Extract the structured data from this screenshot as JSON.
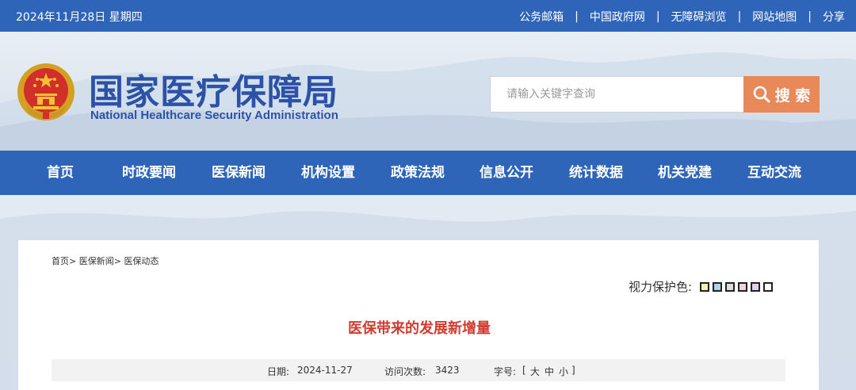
{
  "topbar": {
    "date": "2024年11月28日 星期四",
    "links": [
      "公务邮箱",
      "中国政府网",
      "无障碍浏览",
      "网站地图",
      "分享"
    ],
    "separator": "|"
  },
  "header": {
    "title": "国家医疗保障局",
    "subtitle": "National Healthcare Security Administration",
    "emblem_icon": "national-emblem-icon"
  },
  "search": {
    "placeholder": "请输入关键字查询",
    "button_label": "搜 索",
    "button_color": "#e8895a"
  },
  "nav": {
    "items": [
      "首页",
      "时政要闻",
      "医保新闻",
      "机构设置",
      "政策法规",
      "信息公开",
      "统计数据",
      "机关党建",
      "互动交流"
    ],
    "bg_color": "#2f65b9"
  },
  "breadcrumb": {
    "items": [
      "首页",
      "医保新闻",
      "医保动态"
    ],
    "separator": ">"
  },
  "vision": {
    "label": "视力保护色:",
    "swatches": [
      "#f7f3a8",
      "#a9d4ec",
      "#dcdcdc",
      "#f3d3d8",
      "#dccff0",
      "#ffffff"
    ]
  },
  "article": {
    "title": "医保带来的发展新增量",
    "title_color": "#d33a30",
    "date_label": "日期:",
    "date_value": "2024-11-27",
    "visits_label": "访问次数:",
    "visits_value": "3423",
    "font_label": "字号:",
    "font_open": "[",
    "font_large": "大",
    "font_medium": "中",
    "font_small": "小",
    "font_close": "]"
  }
}
